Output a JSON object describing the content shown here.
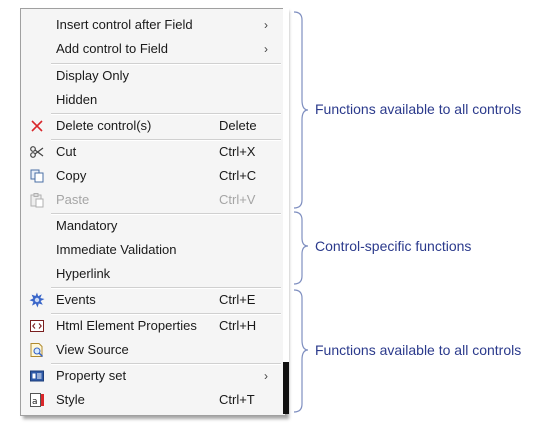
{
  "menu": {
    "items": [
      {
        "label": "Insert control after Field",
        "shortcut": "",
        "submenu": true,
        "enabled": true,
        "icon": ""
      },
      {
        "label": "Add control to Field",
        "shortcut": "",
        "submenu": true,
        "enabled": true,
        "icon": ""
      },
      {
        "label": "Display Only",
        "shortcut": "",
        "submenu": false,
        "enabled": true,
        "icon": ""
      },
      {
        "label": "Hidden",
        "shortcut": "",
        "submenu": false,
        "enabled": true,
        "icon": ""
      },
      {
        "label": "Delete control(s)",
        "shortcut": "Delete",
        "submenu": false,
        "enabled": true,
        "icon": "delete-x-icon"
      },
      {
        "label": "Cut",
        "shortcut": "Ctrl+X",
        "submenu": false,
        "enabled": true,
        "icon": "scissors-icon"
      },
      {
        "label": "Copy",
        "shortcut": "Ctrl+C",
        "submenu": false,
        "enabled": true,
        "icon": "copy-icon"
      },
      {
        "label": "Paste",
        "shortcut": "Ctrl+V",
        "submenu": false,
        "enabled": false,
        "icon": "paste-icon"
      },
      {
        "label": "Mandatory",
        "shortcut": "",
        "submenu": false,
        "enabled": true,
        "icon": ""
      },
      {
        "label": "Immediate Validation",
        "shortcut": "",
        "submenu": false,
        "enabled": true,
        "icon": ""
      },
      {
        "label": "Hyperlink",
        "shortcut": "",
        "submenu": false,
        "enabled": true,
        "icon": ""
      },
      {
        "label": "Events",
        "shortcut": "Ctrl+E",
        "submenu": false,
        "enabled": true,
        "icon": "events-gear-icon"
      },
      {
        "label": "Html Element Properties",
        "shortcut": "Ctrl+H",
        "submenu": false,
        "enabled": true,
        "icon": "html-element-icon"
      },
      {
        "label": "View Source",
        "shortcut": "",
        "submenu": false,
        "enabled": true,
        "icon": "view-source-icon"
      },
      {
        "label": "Property set",
        "shortcut": "",
        "submenu": true,
        "enabled": true,
        "icon": "property-set-icon"
      },
      {
        "label": "Style",
        "shortcut": "Ctrl+T",
        "submenu": false,
        "enabled": true,
        "icon": "style-icon"
      }
    ]
  },
  "annotations": [
    {
      "text": "Functions available to all controls"
    },
    {
      "text": "Control-specific functions"
    },
    {
      "text": "Functions available to all controls"
    }
  ],
  "colors": {
    "annotation_text": "#2b3a8c",
    "bracket": "#7f8fc0",
    "delete_icon": "#d9262a",
    "events_icon": "#3a66c9"
  }
}
